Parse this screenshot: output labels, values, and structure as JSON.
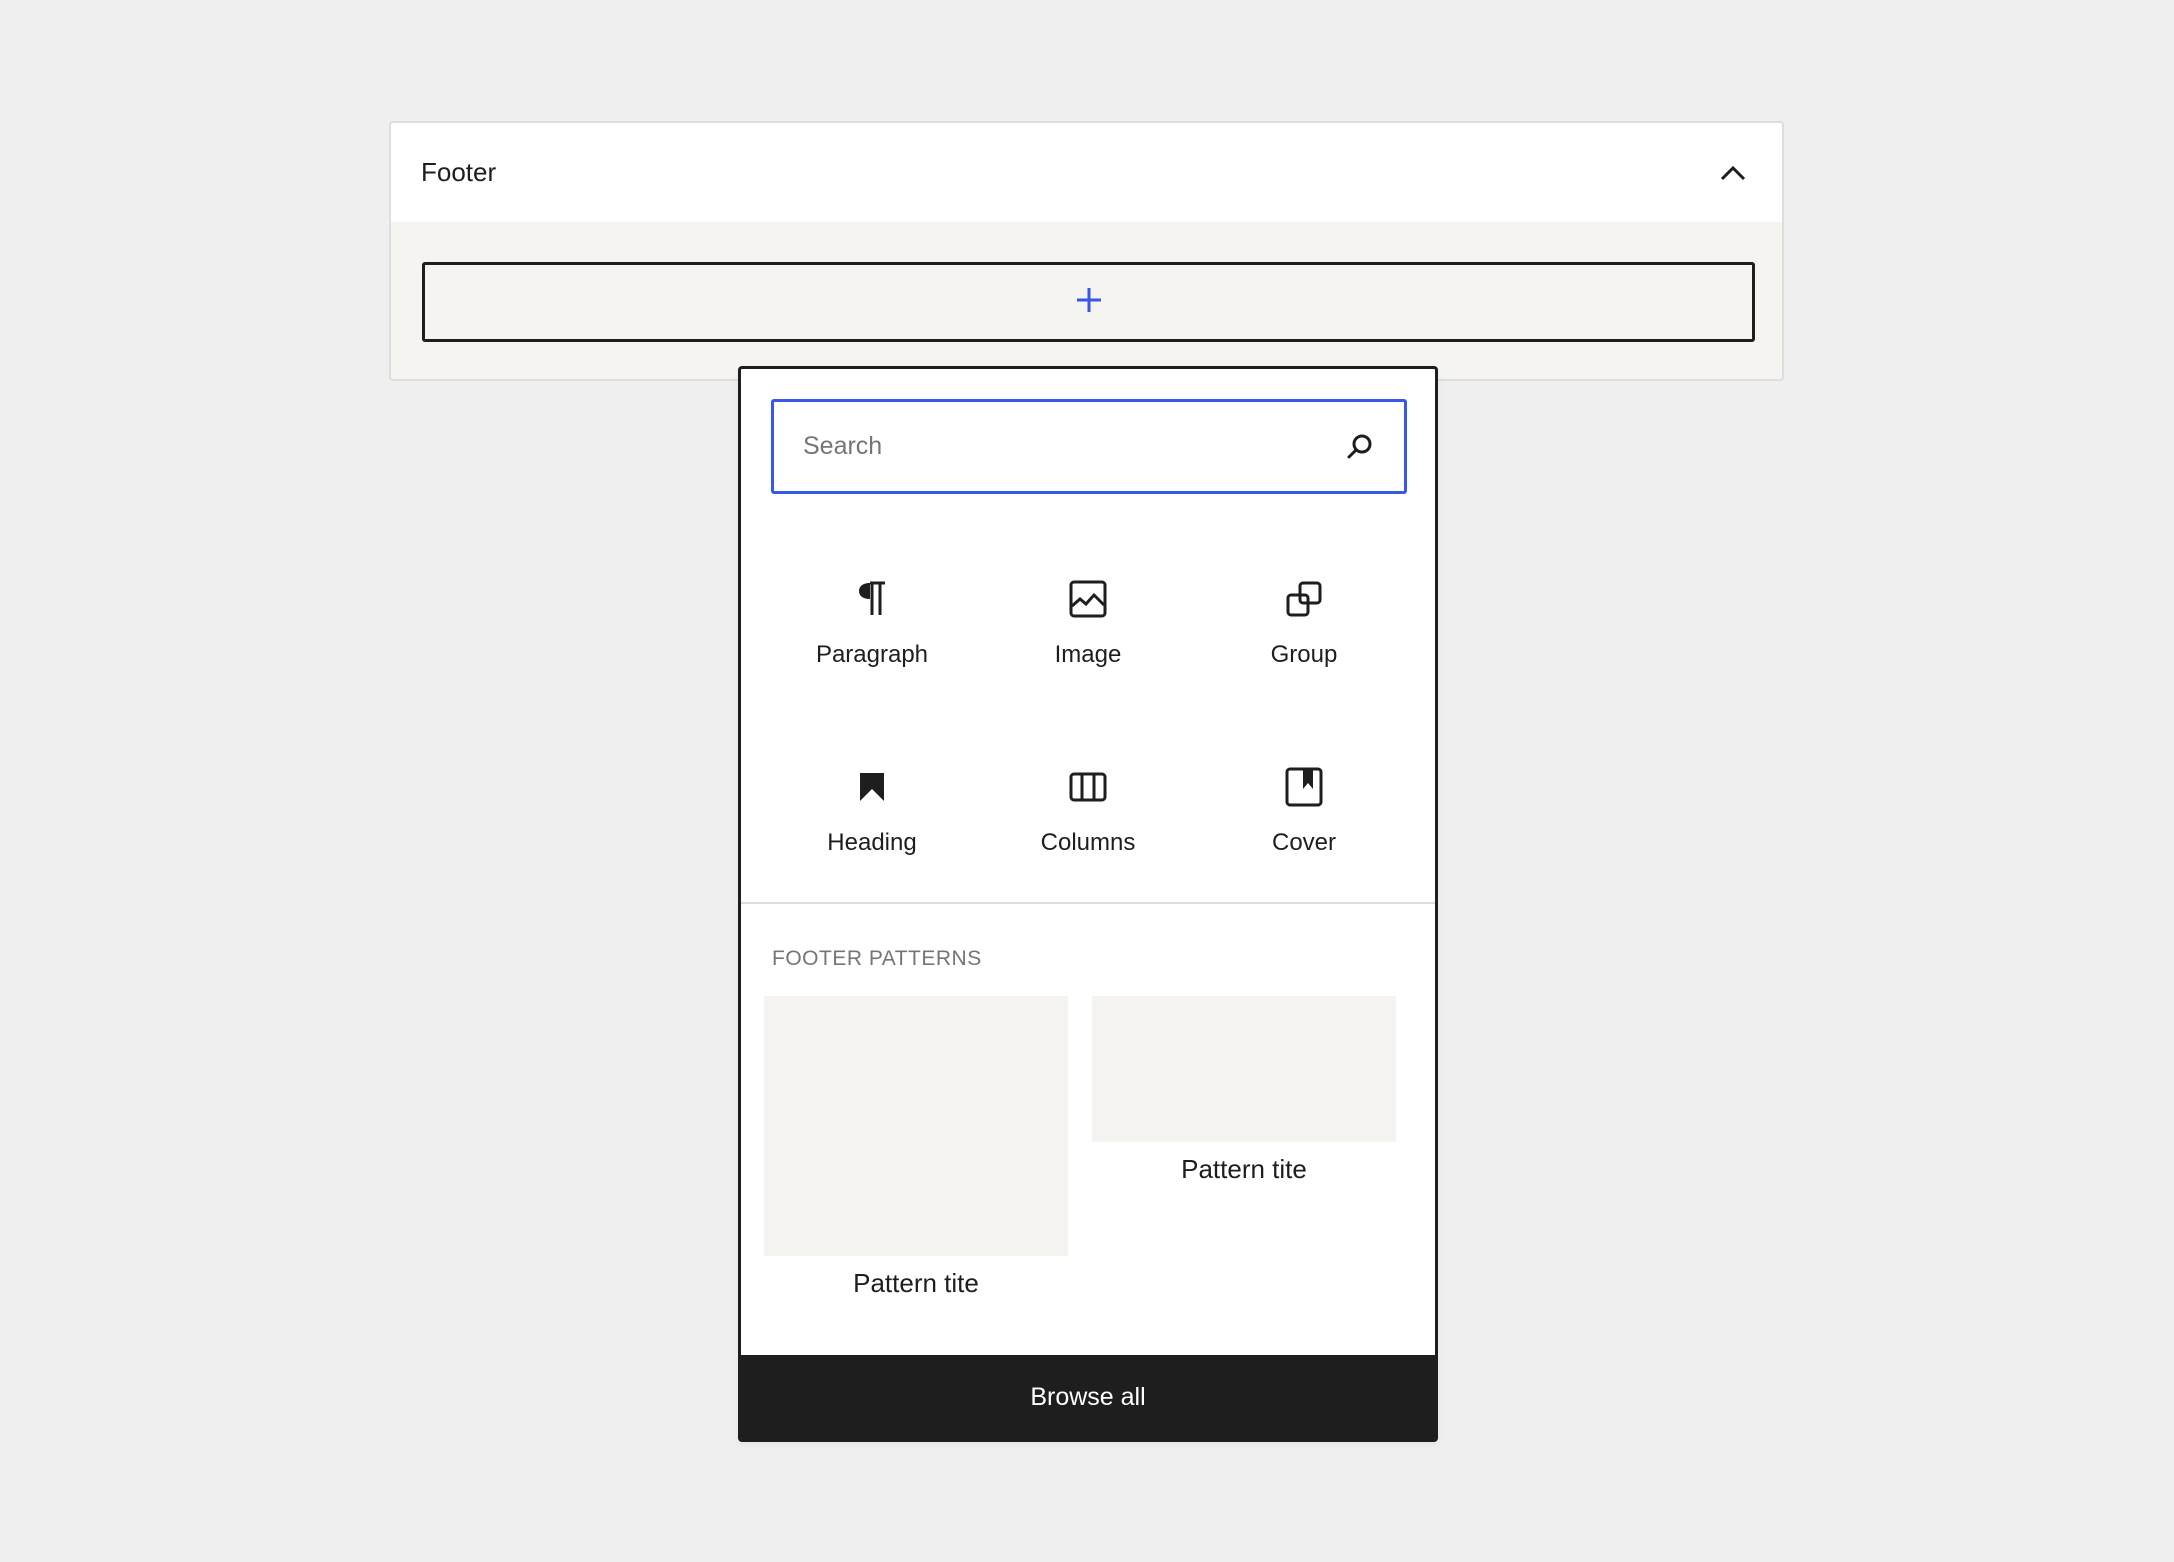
{
  "panel": {
    "title": "Footer",
    "collapse_icon": "chevron-up-icon",
    "add_block_icon": "plus-icon"
  },
  "inserter": {
    "search": {
      "placeholder": "Search",
      "value": "",
      "icon": "search-icon"
    },
    "blocks": [
      {
        "label": "Paragraph",
        "icon": "paragraph-icon"
      },
      {
        "label": "Image",
        "icon": "image-icon"
      },
      {
        "label": "Group",
        "icon": "group-icon"
      },
      {
        "label": "Heading",
        "icon": "heading-icon"
      },
      {
        "label": "Columns",
        "icon": "columns-icon"
      },
      {
        "label": "Cover",
        "icon": "cover-icon"
      }
    ],
    "patterns_title": "FOOTER PATTERNS",
    "patterns": [
      {
        "label": "Pattern tite"
      },
      {
        "label": "Pattern tite"
      }
    ],
    "browse_all_label": "Browse all"
  },
  "colors": {
    "accent": "#3858e9",
    "text": "#1e1e1e",
    "muted": "#757575",
    "canvas": "#f5f4f0",
    "background": "#efefef"
  }
}
